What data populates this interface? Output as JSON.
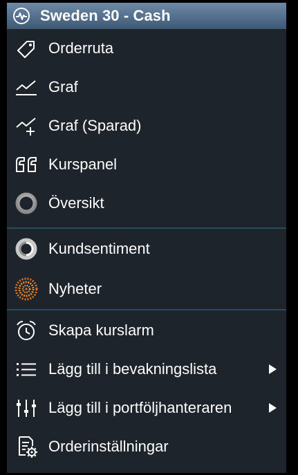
{
  "header": {
    "title": "Sweden 30 - Cash",
    "icon": "activity-pulse-icon"
  },
  "menu": {
    "items": [
      {
        "label": "Orderruta",
        "icon": "tag-icon",
        "submenu": false
      },
      {
        "label": "Graf",
        "icon": "line-chart-icon",
        "submenu": false
      },
      {
        "label": "Graf (Sparad)",
        "icon": "chart-plus-icon",
        "submenu": false
      },
      {
        "label": "Kurspanel",
        "icon": "quote-icon",
        "submenu": false
      },
      {
        "label": "Översikt",
        "icon": "ring-icon",
        "submenu": false
      },
      {
        "label": "Kundsentiment",
        "icon": "sentiment-icon",
        "submenu": false
      },
      {
        "label": "Nyheter",
        "icon": "news-icon",
        "submenu": false
      },
      {
        "label": "Skapa kurslarm",
        "icon": "alarm-clock-icon",
        "submenu": false
      },
      {
        "label": "Lägg till i bevakningslista",
        "icon": "list-icon",
        "submenu": true
      },
      {
        "label": "Lägg till i portföljhanteraren",
        "icon": "sliders-icon",
        "submenu": true
      },
      {
        "label": "Orderinställningar",
        "icon": "document-settings-icon",
        "submenu": false
      }
    ]
  },
  "colors": {
    "background": "#1e242b",
    "header": "#536f8d",
    "divider": "#2c4a5e",
    "text": "#ffffff",
    "news_accent": "#e8721c"
  }
}
